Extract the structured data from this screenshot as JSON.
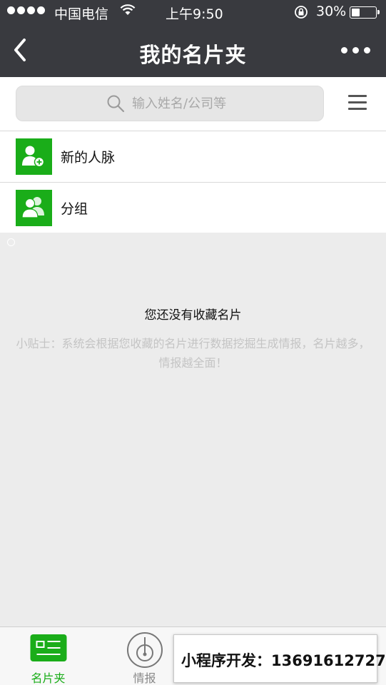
{
  "status_bar": {
    "carrier": "中国电信",
    "time": "上午9:50",
    "battery_percent": "30%",
    "battery_level": 0.3
  },
  "nav": {
    "title": "我的名片夹"
  },
  "search": {
    "placeholder": "输入姓名/公司等"
  },
  "list": {
    "items": [
      {
        "label": "新的人脉",
        "icon": "add-contact-icon"
      },
      {
        "label": "分组",
        "icon": "group-icon"
      }
    ]
  },
  "empty_state": {
    "title": "您还没有收藏名片",
    "tip": "小贴士：系统会根据您收藏的名片进行数据挖掘生成情报，名片越多，情报越全面！"
  },
  "tabbar": {
    "tabs": [
      {
        "label": "名片夹",
        "icon": "business-card-icon",
        "active": true
      },
      {
        "label": "情报",
        "icon": "radar-icon",
        "active": false
      }
    ]
  },
  "promo": {
    "text": "小程序开发：13691612727"
  },
  "colors": {
    "accent": "#1aad19",
    "topbar": "#393a3f",
    "background": "#ececec"
  }
}
